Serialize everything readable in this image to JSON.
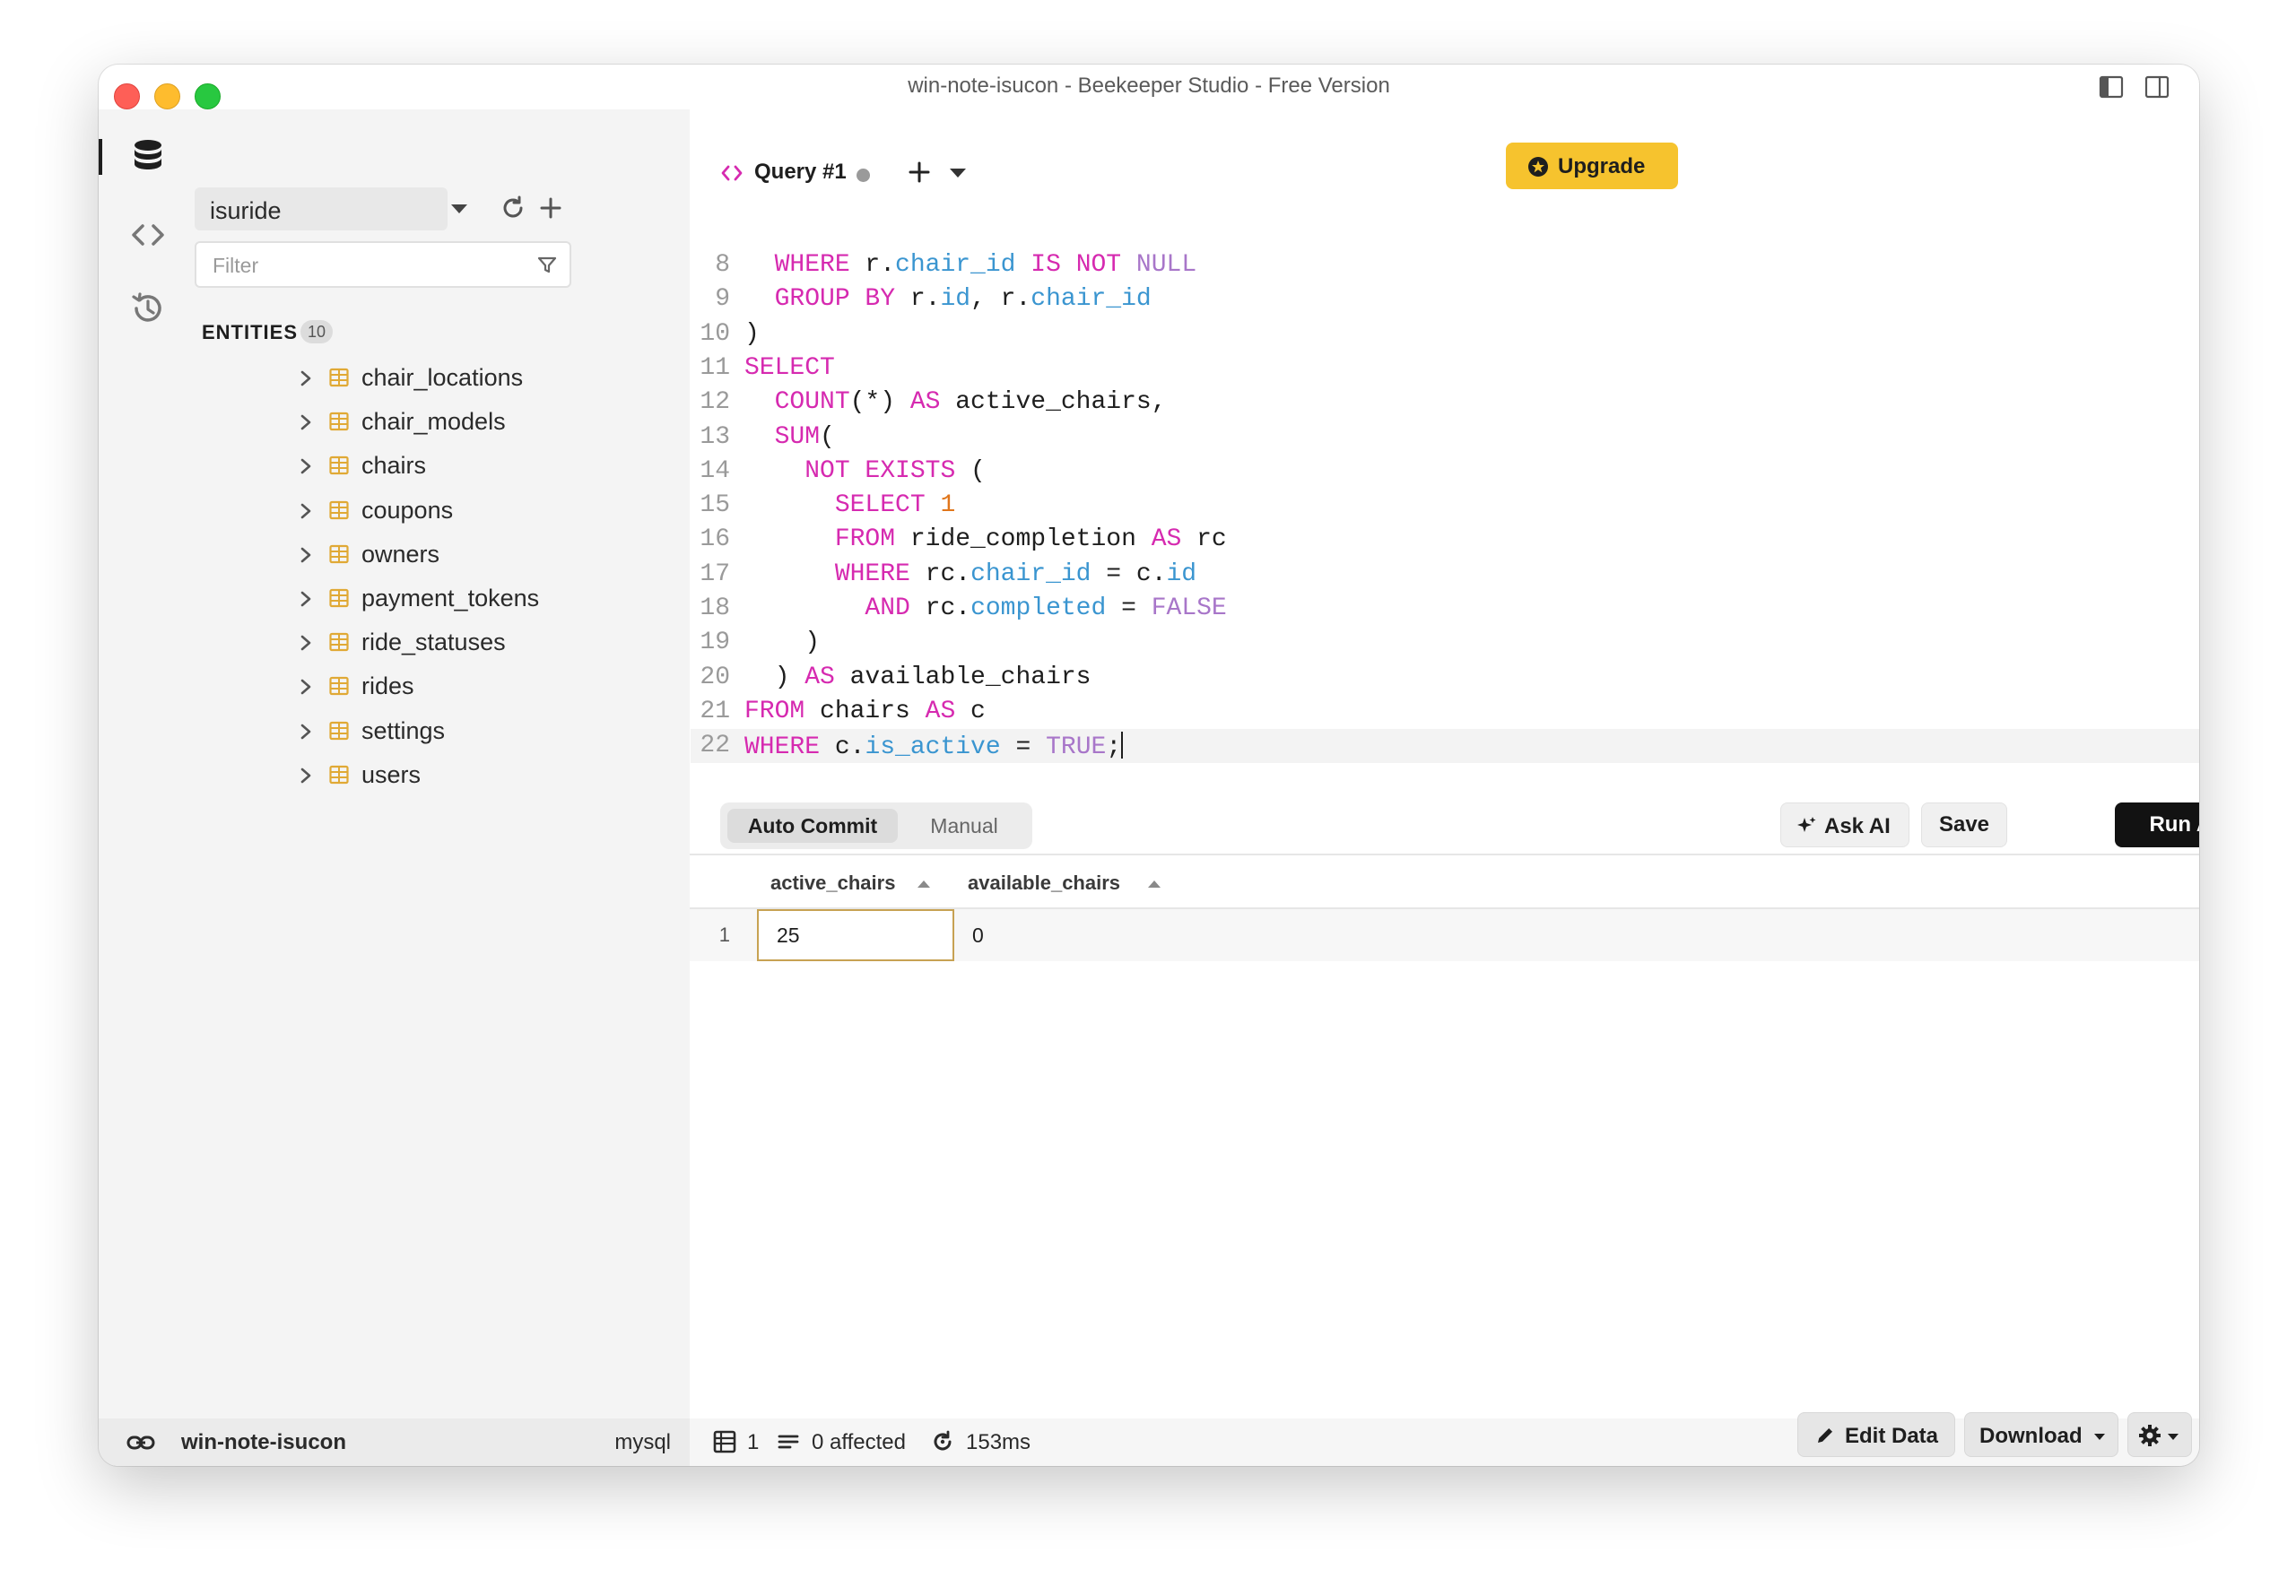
{
  "window": {
    "title": "win-note-isucon - Beekeeper Studio - Free Version"
  },
  "sidebar": {
    "connection": "isuride",
    "filter_placeholder": "Filter",
    "entities_title": "ENTITIES",
    "entities_count": "10",
    "entities": [
      "chair_locations",
      "chair_models",
      "chairs",
      "coupons",
      "owners",
      "payment_tokens",
      "ride_statuses",
      "rides",
      "settings",
      "users"
    ]
  },
  "tabs": [
    {
      "label": "Query #1",
      "unsaved": true
    }
  ],
  "toolbar": {
    "upgrade_label": "Upgrade"
  },
  "editor": {
    "lines": [
      {
        "n": "8",
        "tokens": [
          [
            "  ",
            ""
          ],
          [
            "WHERE",
            "kw"
          ],
          [
            " r.",
            ""
          ],
          [
            "chair_id",
            "fld"
          ],
          [
            " ",
            ""
          ],
          [
            "IS NOT",
            "kw"
          ],
          [
            " ",
            ""
          ],
          [
            "NULL",
            "const"
          ]
        ]
      },
      {
        "n": "9",
        "tokens": [
          [
            "  ",
            ""
          ],
          [
            "GROUP BY",
            "kw"
          ],
          [
            " r.",
            ""
          ],
          [
            "id",
            "fld"
          ],
          [
            ", r.",
            ""
          ],
          [
            "chair_id",
            "fld"
          ]
        ]
      },
      {
        "n": "10",
        "tokens": [
          [
            ")",
            ""
          ]
        ]
      },
      {
        "n": "11",
        "tokens": [
          [
            "SELECT",
            "kw"
          ]
        ]
      },
      {
        "n": "12",
        "tokens": [
          [
            "  ",
            ""
          ],
          [
            "COUNT",
            "kw"
          ],
          [
            "(*) ",
            ""
          ],
          [
            "AS",
            "kw"
          ],
          [
            " active_chairs,",
            ""
          ]
        ]
      },
      {
        "n": "13",
        "tokens": [
          [
            "  ",
            ""
          ],
          [
            "SUM",
            "kw"
          ],
          [
            "(",
            ""
          ]
        ]
      },
      {
        "n": "14",
        "tokens": [
          [
            "    ",
            ""
          ],
          [
            "NOT EXISTS",
            "kw"
          ],
          [
            " (",
            ""
          ]
        ]
      },
      {
        "n": "15",
        "tokens": [
          [
            "      ",
            ""
          ],
          [
            "SELECT",
            "kw"
          ],
          [
            " ",
            ""
          ],
          [
            "1",
            "num"
          ]
        ]
      },
      {
        "n": "16",
        "tokens": [
          [
            "      ",
            ""
          ],
          [
            "FROM",
            "kw"
          ],
          [
            " ride_completion ",
            ""
          ],
          [
            "AS",
            "kw"
          ],
          [
            " rc",
            ""
          ]
        ]
      },
      {
        "n": "17",
        "tokens": [
          [
            "      ",
            ""
          ],
          [
            "WHERE",
            "kw"
          ],
          [
            " rc.",
            ""
          ],
          [
            "chair_id",
            "fld"
          ],
          [
            " = c.",
            ""
          ],
          [
            "id",
            "fld"
          ]
        ]
      },
      {
        "n": "18",
        "tokens": [
          [
            "        ",
            ""
          ],
          [
            "AND",
            "kw"
          ],
          [
            " rc.",
            ""
          ],
          [
            "completed",
            "fld"
          ],
          [
            " = ",
            ""
          ],
          [
            "FALSE",
            "const"
          ]
        ]
      },
      {
        "n": "19",
        "tokens": [
          [
            "    )",
            ""
          ]
        ]
      },
      {
        "n": "20",
        "tokens": [
          [
            "  ) ",
            ""
          ],
          [
            "AS",
            "kw"
          ],
          [
            " available_chairs",
            ""
          ]
        ]
      },
      {
        "n": "21",
        "tokens": [
          [
            "FROM",
            "kw"
          ],
          [
            " chairs ",
            ""
          ],
          [
            "AS",
            "kw"
          ],
          [
            " c",
            ""
          ]
        ]
      },
      {
        "n": "22",
        "tokens": [
          [
            "WHERE",
            "kw"
          ],
          [
            " c.",
            ""
          ],
          [
            "is_active",
            "fld"
          ],
          [
            " = ",
            ""
          ],
          [
            "TRUE",
            "const"
          ],
          [
            ";",
            ""
          ]
        ]
      }
    ]
  },
  "query_actions": {
    "auto_commit": "Auto Commit",
    "manual": "Manual",
    "ask_ai": "Ask AI",
    "save": "Save",
    "run_all": "Run All"
  },
  "results": {
    "columns": [
      "active_chairs",
      "available_chairs"
    ],
    "rows": [
      {
        "n": "1",
        "values": [
          "25",
          "0"
        ]
      }
    ]
  },
  "statusbar": {
    "connection_name": "win-note-isucon",
    "db_type": "mysql",
    "row_count": "1",
    "affected": "0 affected",
    "duration": "153ms",
    "edit_data": "Edit Data",
    "download": "Download"
  }
}
